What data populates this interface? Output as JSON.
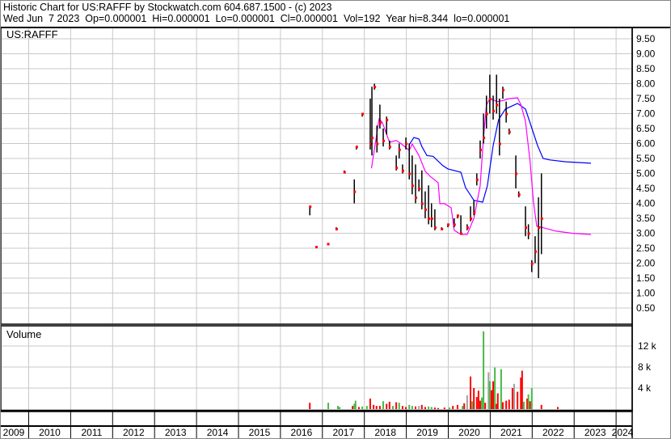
{
  "header": {
    "line1": "Historic Chart for US:RAFFF by Stockwatch.com 604.687.1500 - (c) 2023",
    "line2": "Wed Jun  7 2023  Op=0.000001  Hi=0.000001  Lo=0.000001  Cl=0.000001  Vol=192  Year hi=8.344  lo=0.000001"
  },
  "chart_data": {
    "type": "line",
    "title": "US:RAFFF",
    "volume_title": "Volume",
    "colors": {
      "bar": "#000000",
      "close": "#ff0000",
      "ma_short": "#ff00ff",
      "ma_long": "#0000ff",
      "vol_up": "#44bb44",
      "vol_down": "#ff0000",
      "vol_flat": "#a0a0a0",
      "grid": "#c8c8c8"
    },
    "price_axis": {
      "ylim": [
        0,
        9.85
      ],
      "ticks": [
        "0.50",
        "1.00",
        "1.50",
        "2.00",
        "2.50",
        "3.00",
        "3.50",
        "4.00",
        "4.50",
        "5.00",
        "5.50",
        "6.00",
        "6.50",
        "7.00",
        "7.50",
        "8.00",
        "8.50",
        "9.00",
        "9.50"
      ]
    },
    "volume_axis": {
      "ylim": [
        0,
        16
      ],
      "ticks": [
        {
          "v": 4,
          "label": "4 k"
        },
        {
          "v": 8,
          "label": "8 k"
        },
        {
          "v": 12,
          "label": "12 k"
        }
      ]
    },
    "x_axis": {
      "xlim": [
        2009.32,
        2024.4
      ],
      "years": [
        "2009",
        "2010",
        "2011",
        "2012",
        "2013",
        "2014",
        "2015",
        "2016",
        "2017",
        "2018",
        "2019",
        "2020",
        "2021",
        "2022",
        "2023",
        "2024"
      ]
    },
    "price_bars_t_hi_lo_close": [
      [
        2016.7,
        3.9,
        3.6,
        3.9
      ],
      [
        2016.85,
        2.55,
        2.5,
        2.55
      ],
      [
        2017.13,
        2.65,
        2.6,
        2.65
      ],
      [
        2017.33,
        3.2,
        3.1,
        3.15
      ],
      [
        2017.52,
        5.1,
        5.0,
        5.05
      ],
      [
        2017.76,
        4.8,
        4.0,
        4.4
      ],
      [
        2017.81,
        5.9,
        5.8,
        5.9
      ],
      [
        2017.95,
        7.0,
        6.9,
        7.0
      ],
      [
        2018.14,
        7.5,
        5.8,
        6.0
      ],
      [
        2018.18,
        7.9,
        5.6,
        6.2
      ],
      [
        2018.24,
        8.0,
        7.8,
        7.9
      ],
      [
        2018.3,
        6.6,
        5.7,
        6.0
      ],
      [
        2018.37,
        7.3,
        6.5,
        6.7
      ],
      [
        2018.45,
        6.5,
        5.9,
        6.1
      ],
      [
        2018.53,
        6.9,
        6.3,
        6.8
      ],
      [
        2018.6,
        6.1,
        5.8,
        5.9
      ],
      [
        2018.76,
        5.6,
        5.1,
        5.2
      ],
      [
        2018.83,
        6.0,
        5.5,
        5.8
      ],
      [
        2018.91,
        5.3,
        5.0,
        5.1
      ],
      [
        2018.99,
        6.2,
        5.8,
        6.0
      ],
      [
        2019.07,
        6.0,
        4.8,
        5.0
      ],
      [
        2019.14,
        5.6,
        4.3,
        4.6
      ],
      [
        2019.22,
        5.3,
        4.0,
        4.2
      ],
      [
        2019.3,
        4.8,
        4.4,
        4.5
      ],
      [
        2019.37,
        5.1,
        3.8,
        4.0
      ],
      [
        2019.45,
        4.4,
        3.5,
        3.8
      ],
      [
        2019.53,
        4.6,
        3.3,
        3.5
      ],
      [
        2019.6,
        4.0,
        3.2,
        3.5
      ],
      [
        2019.68,
        3.8,
        3.1,
        3.2
      ],
      [
        2019.84,
        3.2,
        3.1,
        3.15
      ],
      [
        2019.99,
        3.3,
        3.2,
        3.3
      ],
      [
        2020.14,
        3.5,
        3.2,
        3.3
      ],
      [
        2020.22,
        3.6,
        3.5,
        3.6
      ],
      [
        2020.3,
        3.6,
        3.0,
        3.0
      ],
      [
        2020.45,
        3.3,
        3.1,
        3.2
      ],
      [
        2020.53,
        3.9,
        3.4,
        3.5
      ],
      [
        2020.61,
        4.1,
        3.6,
        3.7
      ],
      [
        2020.68,
        5.0,
        4.6,
        4.8
      ],
      [
        2020.76,
        6.1,
        5.5,
        5.8
      ],
      [
        2020.84,
        7.0,
        6.0,
        6.2
      ],
      [
        2020.91,
        7.6,
        6.5,
        7.0
      ],
      [
        2020.99,
        8.3,
        7.0,
        7.5
      ],
      [
        2021.07,
        7.6,
        6.8,
        7.1
      ],
      [
        2021.15,
        8.3,
        7.0,
        7.3
      ],
      [
        2021.22,
        7.5,
        5.6,
        6.0
      ],
      [
        2021.3,
        7.9,
        7.5,
        7.8
      ],
      [
        2021.38,
        7.4,
        6.7,
        7.0
      ],
      [
        2021.45,
        6.5,
        6.3,
        6.4
      ],
      [
        2021.61,
        5.6,
        4.5,
        5.0
      ],
      [
        2021.68,
        4.4,
        4.2,
        4.3
      ],
      [
        2021.84,
        3.9,
        2.9,
        3.2
      ],
      [
        2021.91,
        3.3,
        2.8,
        3.0
      ],
      [
        2021.99,
        2.1,
        1.7,
        2.0
      ],
      [
        2022.07,
        2.9,
        2.0,
        2.4
      ],
      [
        2022.15,
        4.2,
        1.5,
        3.2
      ],
      [
        2022.22,
        5.0,
        2.3,
        3.5
      ]
    ],
    "ma_short": [
      [
        2018.17,
        5.17
      ],
      [
        2018.35,
        6.82
      ],
      [
        2018.43,
        6.7
      ],
      [
        2018.6,
        6.04
      ],
      [
        2018.76,
        6.1
      ],
      [
        2018.87,
        6.0
      ],
      [
        2019.07,
        5.77
      ],
      [
        2019.14,
        5.98
      ],
      [
        2019.3,
        5.6
      ],
      [
        2019.45,
        5.07
      ],
      [
        2019.57,
        4.9
      ],
      [
        2019.76,
        4.69
      ],
      [
        2019.8,
        3.99
      ],
      [
        2019.91,
        3.99
      ],
      [
        2020.07,
        3.85
      ],
      [
        2020.14,
        3.1
      ],
      [
        2020.3,
        2.96
      ],
      [
        2020.45,
        2.96
      ],
      [
        2020.61,
        3.5
      ],
      [
        2020.76,
        4.58
      ],
      [
        2020.84,
        6.2
      ],
      [
        2020.91,
        7.28
      ],
      [
        2020.99,
        7.5
      ],
      [
        2021.17,
        7.4
      ],
      [
        2021.34,
        7.45
      ],
      [
        2021.45,
        7.5
      ],
      [
        2021.65,
        7.53
      ],
      [
        2021.73,
        7.3
      ],
      [
        2021.84,
        6.74
      ],
      [
        2021.95,
        5.39
      ],
      [
        2022.03,
        4.04
      ],
      [
        2022.11,
        3.23
      ],
      [
        2022.22,
        3.2
      ],
      [
        2022.57,
        3.07
      ],
      [
        2022.95,
        3.0
      ],
      [
        2023.4,
        2.96
      ]
    ],
    "ma_long": [
      [
        2019.07,
        5.96
      ],
      [
        2019.18,
        6.2
      ],
      [
        2019.3,
        6.15
      ],
      [
        2019.37,
        5.9
      ],
      [
        2019.49,
        5.6
      ],
      [
        2019.64,
        5.57
      ],
      [
        2019.87,
        5.26
      ],
      [
        2019.99,
        5.15
      ],
      [
        2020.3,
        5.04
      ],
      [
        2020.41,
        4.53
      ],
      [
        2020.61,
        4.1
      ],
      [
        2020.82,
        4.04
      ],
      [
        2020.93,
        4.58
      ],
      [
        2021.07,
        5.93
      ],
      [
        2021.2,
        6.8
      ],
      [
        2021.36,
        7.15
      ],
      [
        2021.65,
        7.34
      ],
      [
        2021.84,
        7.15
      ],
      [
        2021.95,
        6.69
      ],
      [
        2022.13,
        5.93
      ],
      [
        2022.26,
        5.5
      ],
      [
        2022.42,
        5.45
      ],
      [
        2022.8,
        5.39
      ],
      [
        2023.4,
        5.34
      ]
    ],
    "volume_t_k_dir": [
      [
        2016.7,
        1.2,
        "d"
      ],
      [
        2017.14,
        1.2,
        "u"
      ],
      [
        2017.37,
        0.6,
        "u"
      ],
      [
        2017.41,
        0.4,
        "u"
      ],
      [
        2017.72,
        0.6,
        "d"
      ],
      [
        2017.76,
        1.0,
        "u"
      ],
      [
        2017.79,
        1.6,
        "u"
      ],
      [
        2017.87,
        0.4,
        "d"
      ],
      [
        2017.95,
        0.5,
        "u"
      ],
      [
        2018.06,
        0.6,
        "u"
      ],
      [
        2018.14,
        2.0,
        "d"
      ],
      [
        2018.22,
        0.8,
        "d"
      ],
      [
        2018.29,
        0.6,
        "d"
      ],
      [
        2018.37,
        0.6,
        "d"
      ],
      [
        2018.45,
        1.5,
        "u"
      ],
      [
        2018.53,
        1.0,
        "d"
      ],
      [
        2018.6,
        1.4,
        "d"
      ],
      [
        2018.68,
        0.6,
        "u"
      ],
      [
        2018.76,
        1.3,
        "d"
      ],
      [
        2018.83,
        1.2,
        "u"
      ],
      [
        2018.91,
        0.6,
        "d"
      ],
      [
        2018.99,
        0.4,
        "d"
      ],
      [
        2019.07,
        0.8,
        "u"
      ],
      [
        2019.14,
        0.6,
        "u"
      ],
      [
        2019.22,
        0.5,
        "d"
      ],
      [
        2019.3,
        0.6,
        "f"
      ],
      [
        2019.37,
        0.8,
        "d"
      ],
      [
        2019.45,
        0.4,
        "d"
      ],
      [
        2019.53,
        0.5,
        "u"
      ],
      [
        2019.6,
        0.4,
        "u"
      ],
      [
        2019.68,
        0.3,
        "d"
      ],
      [
        2019.76,
        0.2,
        "d"
      ],
      [
        2019.91,
        0.3,
        "d"
      ],
      [
        2020.03,
        0.3,
        "u"
      ],
      [
        2020.11,
        0.6,
        "d"
      ],
      [
        2020.22,
        0.8,
        "d"
      ],
      [
        2020.34,
        0.6,
        "u"
      ],
      [
        2020.38,
        1.1,
        "d"
      ],
      [
        2020.45,
        2.6,
        "f"
      ],
      [
        2020.53,
        6.2,
        "d"
      ],
      [
        2020.57,
        1.5,
        "u"
      ],
      [
        2020.61,
        4.0,
        "d"
      ],
      [
        2020.68,
        2.3,
        "d"
      ],
      [
        2020.72,
        3.5,
        "d"
      ],
      [
        2020.76,
        1.6,
        "d"
      ],
      [
        2020.8,
        2.2,
        "u"
      ],
      [
        2020.84,
        14.8,
        "u"
      ],
      [
        2020.88,
        1.2,
        "d"
      ],
      [
        2020.96,
        7.0,
        "f"
      ],
      [
        2020.99,
        5.3,
        "u"
      ],
      [
        2021.03,
        3.6,
        "d"
      ],
      [
        2021.07,
        5.3,
        "d"
      ],
      [
        2021.11,
        7.9,
        "u"
      ],
      [
        2021.15,
        1.0,
        "d"
      ],
      [
        2021.18,
        3.0,
        "d"
      ],
      [
        2021.26,
        7.6,
        "u"
      ],
      [
        2021.3,
        1.3,
        "d"
      ],
      [
        2021.38,
        1.6,
        "d"
      ],
      [
        2021.45,
        1.8,
        "d"
      ],
      [
        2021.53,
        4.0,
        "d"
      ],
      [
        2021.57,
        4.8,
        "f"
      ],
      [
        2021.65,
        3.3,
        "d"
      ],
      [
        2021.73,
        6.0,
        "d"
      ],
      [
        2021.76,
        7.3,
        "d"
      ],
      [
        2021.8,
        1.4,
        "u"
      ],
      [
        2021.88,
        2.0,
        "d"
      ],
      [
        2021.91,
        2.8,
        "u"
      ],
      [
        2021.95,
        1.5,
        "d"
      ],
      [
        2021.99,
        4.0,
        "u"
      ],
      [
        2022.22,
        0.8,
        "d"
      ],
      [
        2022.61,
        0.4,
        "d"
      ]
    ]
  }
}
